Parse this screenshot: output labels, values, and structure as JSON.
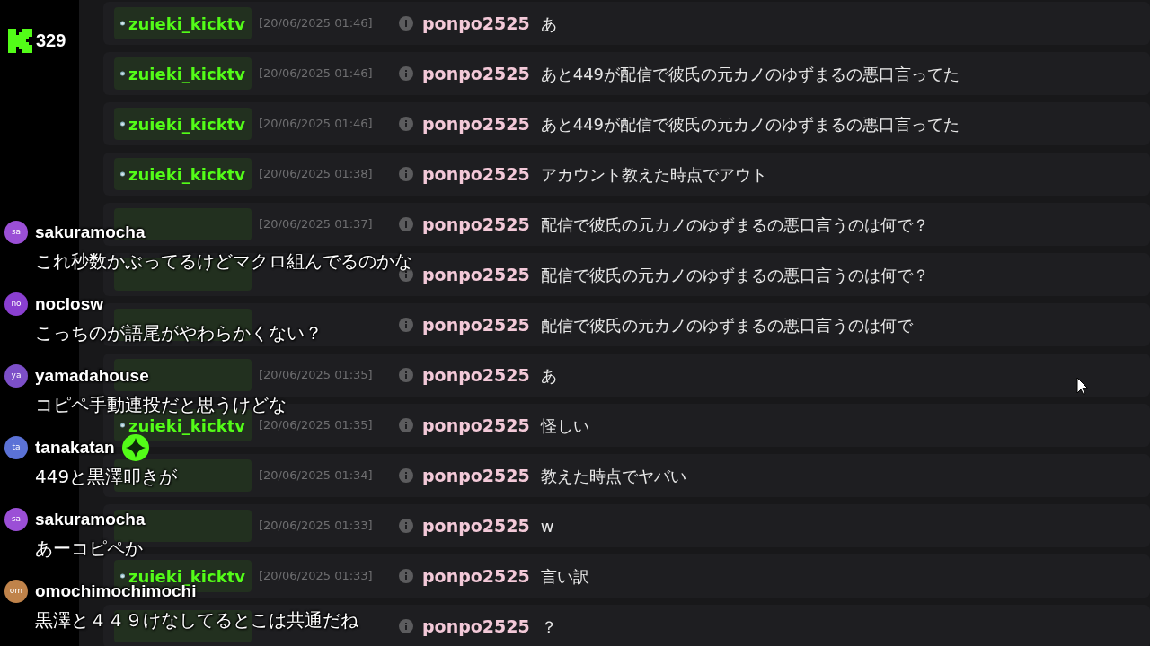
{
  "viewer_count": "329",
  "log_rows": [
    {
      "channel": "zuieki_kicktv",
      "timestamp": "[20/06/2025 01:46]",
      "user": "ponpo2525",
      "message": "あ"
    },
    {
      "channel": "zuieki_kicktv",
      "timestamp": "[20/06/2025 01:46]",
      "user": "ponpo2525",
      "message": "あと449が配信で彼氏の元カノのゆずまるの悪口言ってた"
    },
    {
      "channel": "zuieki_kicktv",
      "timestamp": "[20/06/2025 01:46]",
      "user": "ponpo2525",
      "message": "あと449が配信で彼氏の元カノのゆずまるの悪口言ってた"
    },
    {
      "channel": "zuieki_kicktv",
      "timestamp": "[20/06/2025 01:38]",
      "user": "ponpo2525",
      "message": "アカウント教えた時点でアウト"
    },
    {
      "timestamp": "[20/06/2025 01:37]",
      "user": "ponpo2525",
      "message": "配信で彼氏の元カノのゆずまるの悪口言うのは何で？"
    },
    {
      "user": "ponpo2525",
      "message": "配信で彼氏の元カノのゆずまるの悪口言うのは何で？"
    },
    {
      "user": "ponpo2525",
      "message": "配信で彼氏の元カノのゆずまるの悪口言うのは何で"
    },
    {
      "timestamp": "[20/06/2025 01:35]",
      "user": "ponpo2525",
      "message": "あ"
    },
    {
      "channel": "zuieki_kicktv",
      "timestamp": "[20/06/2025 01:35]",
      "user": "ponpo2525",
      "message": "怪しい"
    },
    {
      "timestamp": "[20/06/2025 01:34]",
      "user": "ponpo2525",
      "message": "教えた時点でヤバい"
    },
    {
      "timestamp": "[20/06/2025 01:33]",
      "user": "ponpo2525",
      "message": "w"
    },
    {
      "channel": "zuieki_kicktv",
      "timestamp": "[20/06/2025 01:33]",
      "user": "ponpo2525",
      "message": "言い訳"
    },
    {
      "user": "ponpo2525",
      "message": "？"
    }
  ],
  "chat_overlay": [
    {
      "initials": "sa",
      "color": "#9b4fd6",
      "username": "sakuramocha",
      "verified": false,
      "message": "これ秒数かぶってるけどマクロ組んでるのかな"
    },
    {
      "initials": "no",
      "color": "#8a3fd0",
      "username": "noclosw",
      "verified": false,
      "message": "こっちのが語尾がやわらかくない？"
    },
    {
      "initials": "ya",
      "color": "#7c4fc8",
      "username": "yamadahouse",
      "verified": false,
      "message": "コピペ手動連投だと思うけどな"
    },
    {
      "initials": "ta",
      "color": "#5b72d6",
      "username": "tanakatan",
      "verified": true,
      "message": "449と黒澤叩きが"
    },
    {
      "initials": "sa",
      "color": "#9b4fd6",
      "username": "sakuramocha",
      "verified": false,
      "message": "あーコピペか"
    },
    {
      "initials": "om",
      "color": "#c0834a",
      "username": "omochimochimochi",
      "verified": false,
      "message": "黒澤と４４９けなしてるとこは共通だね"
    }
  ]
}
